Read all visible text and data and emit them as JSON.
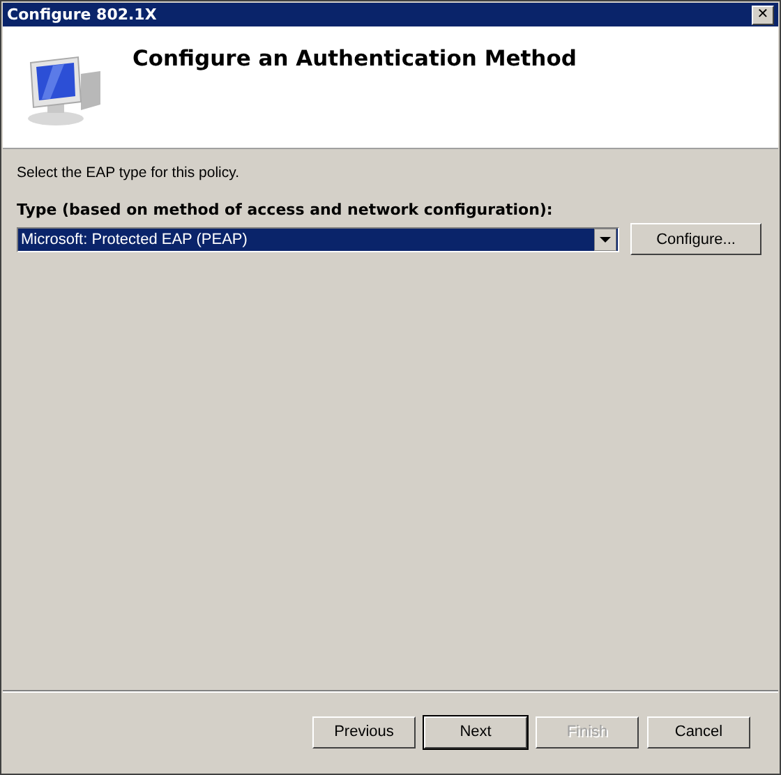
{
  "window": {
    "title": "Configure 802.1X",
    "close": "✕"
  },
  "header": {
    "title": "Configure an Authentication Method"
  },
  "instruction": "Select the EAP type for this policy.",
  "type_field": {
    "label": "Type (based on method of access and network configuration):",
    "value": "Microsoft: Protected EAP (PEAP)",
    "button": "Configure..."
  },
  "buttons": [
    {
      "label": "Previous",
      "default": false,
      "disabled": false
    },
    {
      "label": "Next",
      "default": true,
      "disabled": false
    },
    {
      "label": "Finish",
      "default": false,
      "disabled": true
    },
    {
      "label": "Cancel",
      "default": false,
      "disabled": false
    }
  ]
}
